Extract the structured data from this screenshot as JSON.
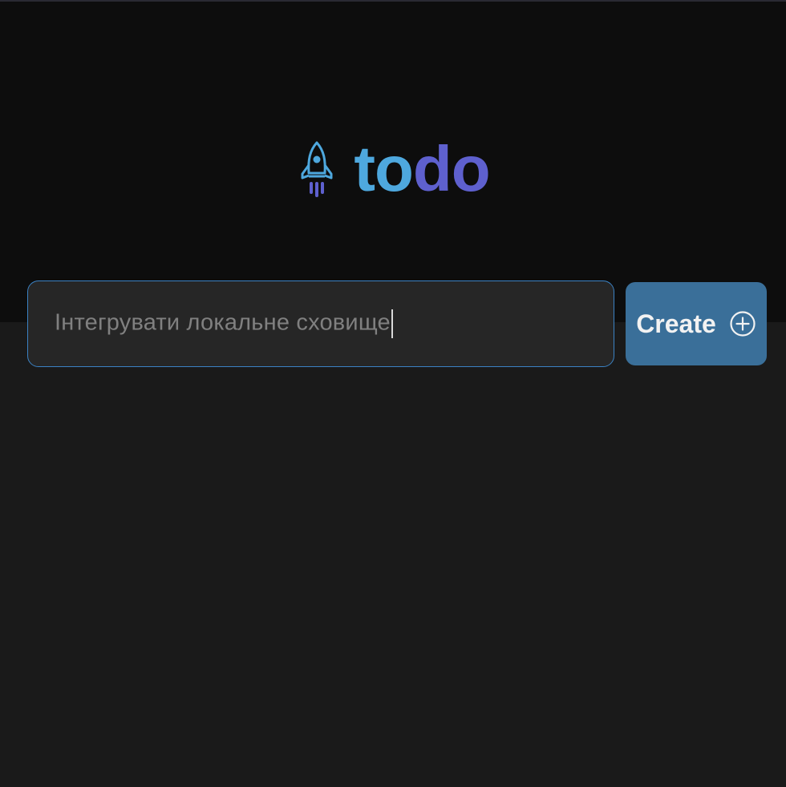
{
  "logo": {
    "icon": "rocket-icon",
    "text_part1": "to",
    "text_part2": "do",
    "colors": {
      "primary": "#4ea8de",
      "secondary": "#5e60ce"
    }
  },
  "new_task": {
    "placeholder": "Інтегрувати локальне сховище",
    "value": "Інтегрувати локальне сховище",
    "create_label": "Create",
    "create_icon": "plus-circle-icon"
  },
  "colors": {
    "header_bg": "#0d0d0d",
    "body_bg": "#1a1a1a",
    "input_bg": "#262626",
    "input_border": "#3b82c4",
    "button_bg": "#3a6f99"
  }
}
